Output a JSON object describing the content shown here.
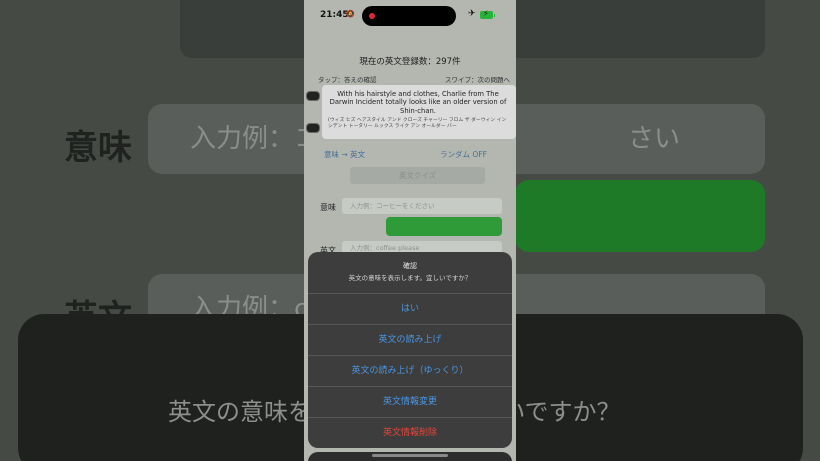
{
  "status_bar": {
    "time": "21:45",
    "bell_icon": "bell-slash-icon",
    "plane_icon": "airplane-icon"
  },
  "header": {
    "count_text": "現在の英文登録数：297件",
    "hint_left": "タップ：答えの確認",
    "hint_right": "スワイプ：次の問題へ"
  },
  "card": {
    "sentence": "With his hairstyle and clothes, Charlie from The Darwin Incident totally looks like an older version of Shin-chan.",
    "reading": "(ウィズ ヒズ ヘアスタイル アンド クローズ チャーリー フロム ザ ダーウィン インシデント トータリー ルックス ライク アン オールダー バー"
  },
  "modes": {
    "direction": "意味 → 英文",
    "random": "ランダム OFF"
  },
  "quiz_button": "英文クイズ",
  "form": {
    "meaning_label": "意味",
    "meaning_placeholder": "入力例：コーヒーをください",
    "english_label": "英文",
    "english_placeholder": "入力例：coffee please"
  },
  "alert": {
    "title": "確認",
    "message": "英文の意味を表示します。宜しいですか？",
    "buttons": [
      "はい",
      "英文の読み上げ",
      "英文の読み上げ（ゆっくり）",
      "英文情報変更",
      "英文情報削除"
    ]
  },
  "background": {
    "meaning_label": "意味",
    "meaning_placeholder": "入力例：コ",
    "meaning_placeholder_tail": "さい",
    "english_label": "英文",
    "english_placeholder": "入力例：c",
    "dialog_text_left": "英文の意味を",
    "dialog_text_right": "しいですか？"
  },
  "colors": {
    "accent_blue": "#4b96e4",
    "danger_red": "#e8453c",
    "green": "#2f9a38"
  }
}
